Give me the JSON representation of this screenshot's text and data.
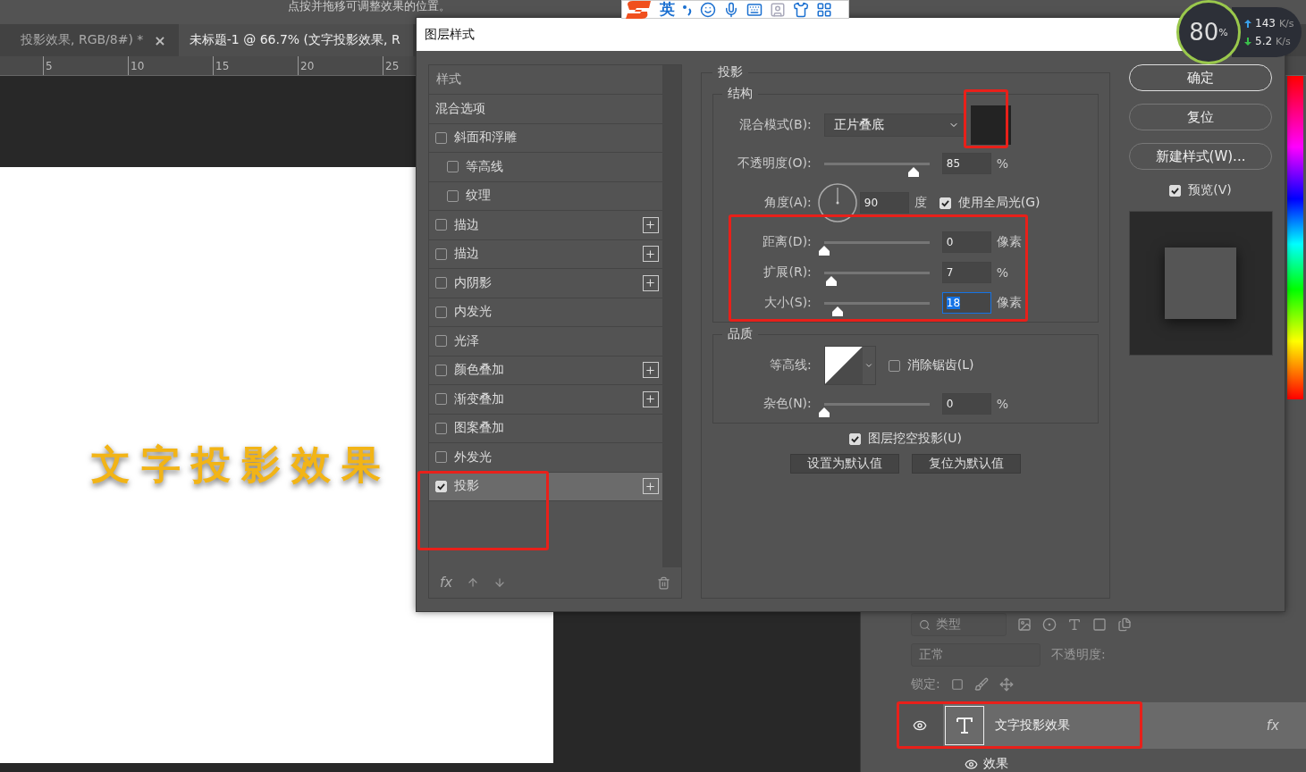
{
  "top_hint": "点按并拖移可调整效果的位置。",
  "doc_tabs": [
    {
      "label": "投影效果, RGB/8#) *",
      "close": "×",
      "selected": false
    },
    {
      "label": "未标题-1 @ 66.7% (文字投影效果, R",
      "selected": true
    }
  ],
  "ruler_ticks": [
    "5",
    "10",
    "15",
    "20",
    "25"
  ],
  "canvas_text": "文字投影效果",
  "ime_toolbar": {
    "language": "英"
  },
  "net_monitor": {
    "percent": "80",
    "percent_unit": "%",
    "upload": "143",
    "upload_unit": "K/s",
    "download": "5.2",
    "download_unit": "K/s"
  },
  "dialog": {
    "title": "图层样式",
    "styles_header": "样式",
    "style_items": [
      {
        "label": "混合选项",
        "kind": "plain",
        "selected": false
      },
      {
        "label": "斜面和浮雕",
        "kind": "check",
        "checked": false,
        "add": false,
        "selected": false
      },
      {
        "label": "等高线",
        "kind": "sub",
        "checked": false,
        "add": false,
        "selected": false
      },
      {
        "label": "纹理",
        "kind": "sub",
        "checked": false,
        "add": false,
        "selected": false
      },
      {
        "label": "描边",
        "kind": "check",
        "checked": false,
        "add": true,
        "selected": false
      },
      {
        "label": "描边",
        "kind": "check",
        "checked": false,
        "add": true,
        "selected": false
      },
      {
        "label": "内阴影",
        "kind": "check",
        "checked": false,
        "add": true,
        "selected": false
      },
      {
        "label": "内发光",
        "kind": "check",
        "checked": false,
        "add": false,
        "selected": false
      },
      {
        "label": "光泽",
        "kind": "check",
        "checked": false,
        "add": false,
        "selected": false
      },
      {
        "label": "颜色叠加",
        "kind": "check",
        "checked": false,
        "add": true,
        "selected": false
      },
      {
        "label": "渐变叠加",
        "kind": "check",
        "checked": false,
        "add": true,
        "selected": false
      },
      {
        "label": "图案叠加",
        "kind": "check",
        "checked": false,
        "add": false,
        "selected": false
      },
      {
        "label": "外发光",
        "kind": "check",
        "checked": false,
        "add": false,
        "selected": false
      },
      {
        "label": "投影",
        "kind": "check",
        "checked": true,
        "add": true,
        "selected": true
      }
    ],
    "fx_label": "fx",
    "section_title": "投影",
    "structure": {
      "title": "结构",
      "blend_label": "混合模式(B):",
      "blend_value": "正片叠底",
      "color": "#232323",
      "opacity": {
        "label": "不透明度(O):",
        "level": 0.85,
        "value": "85",
        "unit": "%"
      },
      "angle": {
        "label": "角度(A):",
        "value": "90",
        "unit": "度"
      },
      "global_light": {
        "label": "使用全局光(G)",
        "checked": true
      },
      "sliders": [
        {
          "label": "距离(D):",
          "level": 0,
          "value": "0",
          "unit": "像素",
          "focused": false
        },
        {
          "label": "扩展(R):",
          "level": 0.07,
          "value": "7",
          "unit": "%",
          "focused": false
        },
        {
          "label": "大小(S):",
          "level": 0.13,
          "value": "18",
          "unit": "像素",
          "focused": true
        }
      ]
    },
    "quality": {
      "title": "品质",
      "contour_label": "等高线:",
      "anti_alias": {
        "label": "消除锯齿(L)",
        "checked": false
      },
      "noise": {
        "label": "杂色(N):",
        "level": 0,
        "value": "0",
        "unit": "%"
      }
    },
    "knockout": {
      "label": "图层挖空投影(U)",
      "checked": true
    },
    "default_buttons": [
      "设置为默认值",
      "复位为默认值"
    ],
    "side_buttons": [
      {
        "label": "确定",
        "primary": true
      },
      {
        "label": "复位",
        "primary": false
      },
      {
        "label": "新建样式(W)...",
        "primary": false
      }
    ],
    "preview": {
      "label": "预览(V)",
      "checked": true
    }
  },
  "layers": {
    "filter_placeholder": "类型",
    "blend_mode": "正常",
    "opacity_label": "不透明度:",
    "lock_label": "锁定:",
    "layer": {
      "name": "文字投影效果",
      "fx": "fx",
      "visible": true
    },
    "effects": {
      "label": "效果",
      "visible": true
    }
  }
}
